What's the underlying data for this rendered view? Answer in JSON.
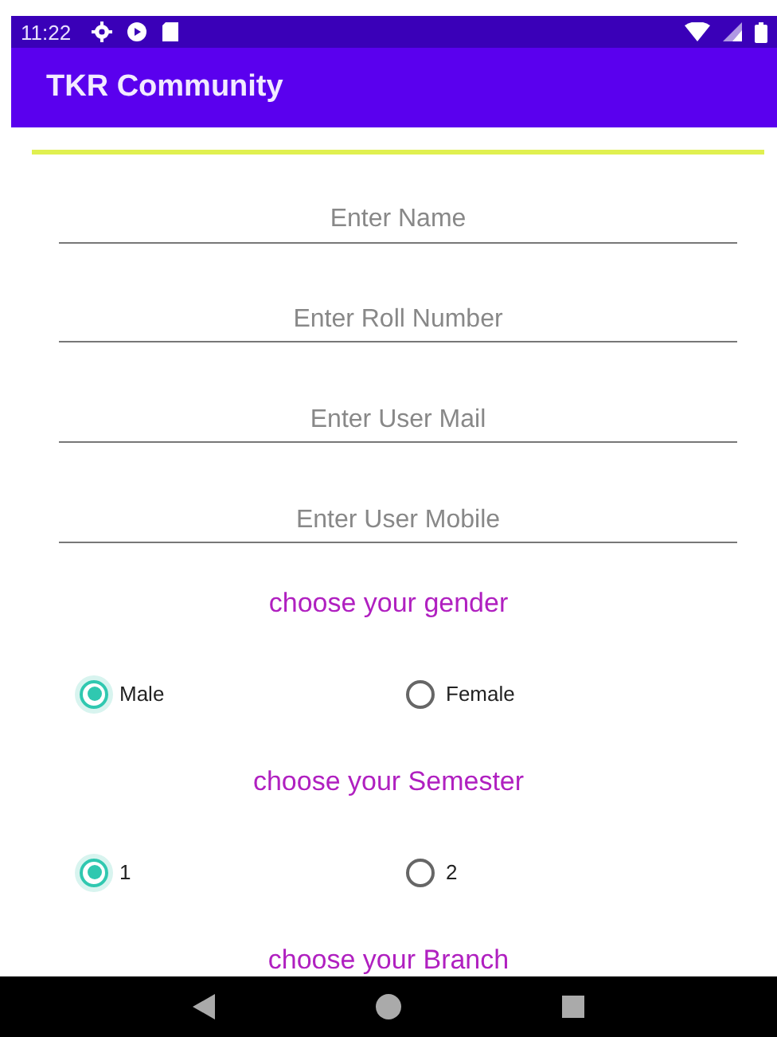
{
  "status_bar": {
    "time": "11:22"
  },
  "app_bar": {
    "title": "TKR Community"
  },
  "fields": [
    {
      "placeholder": "Enter Name"
    },
    {
      "placeholder": "Enter Roll Number"
    },
    {
      "placeholder": "Enter User Mail"
    },
    {
      "placeholder": "Enter User Mobile"
    }
  ],
  "groups": [
    {
      "heading": "choose your gender",
      "options": [
        {
          "label": "Male",
          "selected": true
        },
        {
          "label": "Female",
          "selected": false
        }
      ]
    },
    {
      "heading": "choose your Semester",
      "options": [
        {
          "label": "1",
          "selected": true
        },
        {
          "label": "2",
          "selected": false
        }
      ]
    },
    {
      "heading": "choose your Branch"
    }
  ]
}
